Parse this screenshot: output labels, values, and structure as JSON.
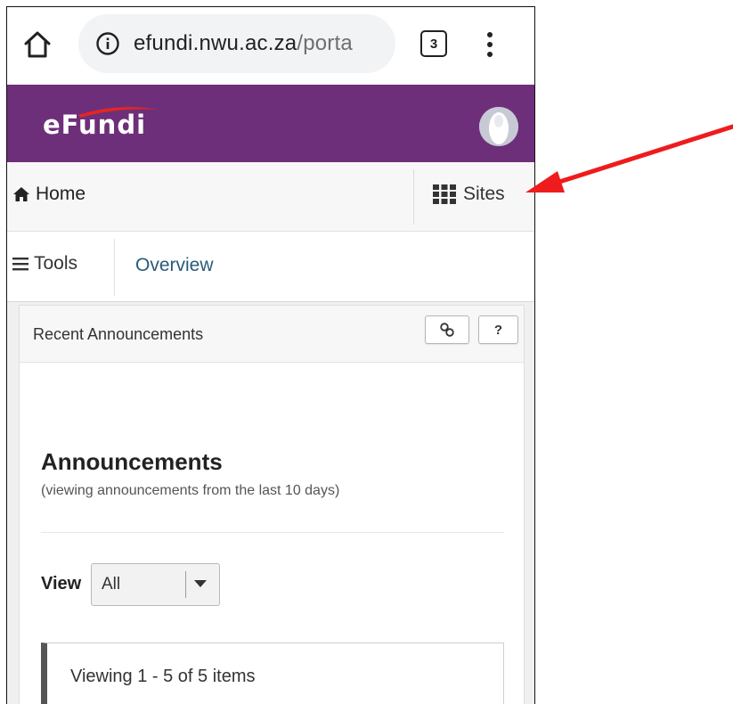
{
  "browser": {
    "url_main": "efundi.nwu.ac.za",
    "url_rest": "/porta",
    "tab_count": "3",
    "icons": {
      "home": "home-icon",
      "info": "info-icon",
      "menu": "more-vert-icon"
    }
  },
  "header": {
    "logo_text": "eFundi",
    "brand_color": "#6e2f7a",
    "accent_color": "#e52521"
  },
  "nav": {
    "home_label": "Home",
    "sites_label": "Sites"
  },
  "tools_bar": {
    "tools_label": "Tools",
    "overview_label": "Overview"
  },
  "portlet": {
    "title": "Recent Announcements",
    "help_label": "?",
    "heading": "Announcements",
    "subheading": "(viewing announcements from the last 10 days)",
    "view_label": "View",
    "view_selected": "All",
    "items_text": "Viewing 1 - 5 of 5 items"
  },
  "annotation": {
    "arrow_color": "#ee1c1c"
  }
}
